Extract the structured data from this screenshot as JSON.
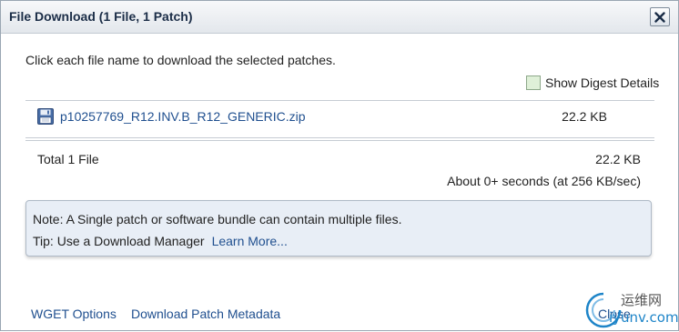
{
  "dialog": {
    "title": "File Download (1 File, 1 Patch)",
    "close_icon": "close-x-icon"
  },
  "intro": "Click each file name to download the selected patches.",
  "digest": {
    "label": "Show Digest Details",
    "checked": false
  },
  "files": [
    {
      "icon": "floppy-disk-icon",
      "name": "p10257769_R12.INV.B_R12_GENERIC.zip",
      "size": "22.2 KB"
    }
  ],
  "totals": {
    "label": "Total 1 File",
    "size": "22.2 KB",
    "eta": "About 0+ seconds (at 256 KB/sec)"
  },
  "note_box": {
    "note": "Note: A Single patch or software bundle can contain multiple files.",
    "tip": "Tip: Use a Download Manager",
    "learn_more": "Learn More..."
  },
  "footer": {
    "wget": "WGET Options",
    "metadata": "Download Patch Metadata",
    "close": "Close"
  },
  "watermark": {
    "top": "运维网",
    "bottom": "iyunv.com"
  },
  "colors": {
    "link": "#1f4f8f",
    "title": "#1b2d47",
    "note_bg": "#e8eef6"
  }
}
